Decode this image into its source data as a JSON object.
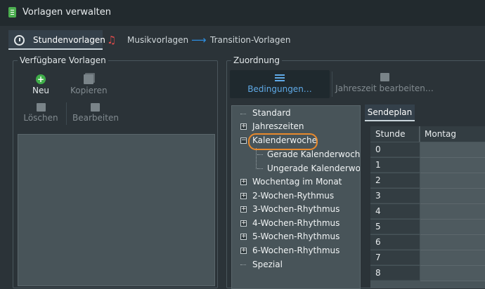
{
  "window": {
    "title": "Vorlagen verwalten"
  },
  "tabs": [
    {
      "label": "Stundenvorlagen",
      "icon": "clock-icon",
      "active": true
    },
    {
      "label": "Musikvorlagen",
      "icon": "music-note-icon"
    },
    {
      "label": "Transition-Vorlagen",
      "icon": "arrow-right-icon"
    }
  ],
  "available": {
    "legend": "Verfügbare Vorlagen",
    "toolbar": {
      "new_label": "Neu",
      "copy_label": "Kopieren",
      "delete_label": "Löschen",
      "edit_label": "Bearbeiten"
    }
  },
  "assignment": {
    "legend": "Zuordnung",
    "conditions_label": "Bedingungen…",
    "season_label": "Jahreszeit bearbeiten…",
    "tree": [
      {
        "label": "Standard"
      },
      {
        "label": "Jahreszeiten"
      },
      {
        "label": "Kalenderwoche",
        "expanded": true,
        "highlighted": true
      },
      {
        "label": "Gerade Kalenderwoche"
      },
      {
        "label": "Ungerade Kalenderwoche"
      },
      {
        "label": "Wochentag im Monat"
      },
      {
        "label": "2-Wochen-Rythmus"
      },
      {
        "label": "3-Wochen-Rhythmus"
      },
      {
        "label": "4-Wochen-Rhythmus"
      },
      {
        "label": "5-Wochen-Rhythmus"
      },
      {
        "label": "6-Wochen-Rhythmus"
      },
      {
        "label": "Spezial"
      }
    ],
    "schedule": {
      "tab_label": "Sendeplan",
      "columns": [
        "Stunde",
        "Montag"
      ],
      "rows": [
        "0",
        "1",
        "2",
        "3",
        "4",
        "5",
        "6",
        "7",
        "8"
      ]
    }
  },
  "colors": {
    "accent_blue": "#5fa9e6",
    "highlight_orange": "#e8892c",
    "new_green": "#3fae49",
    "music_red": "#e14b4b"
  }
}
